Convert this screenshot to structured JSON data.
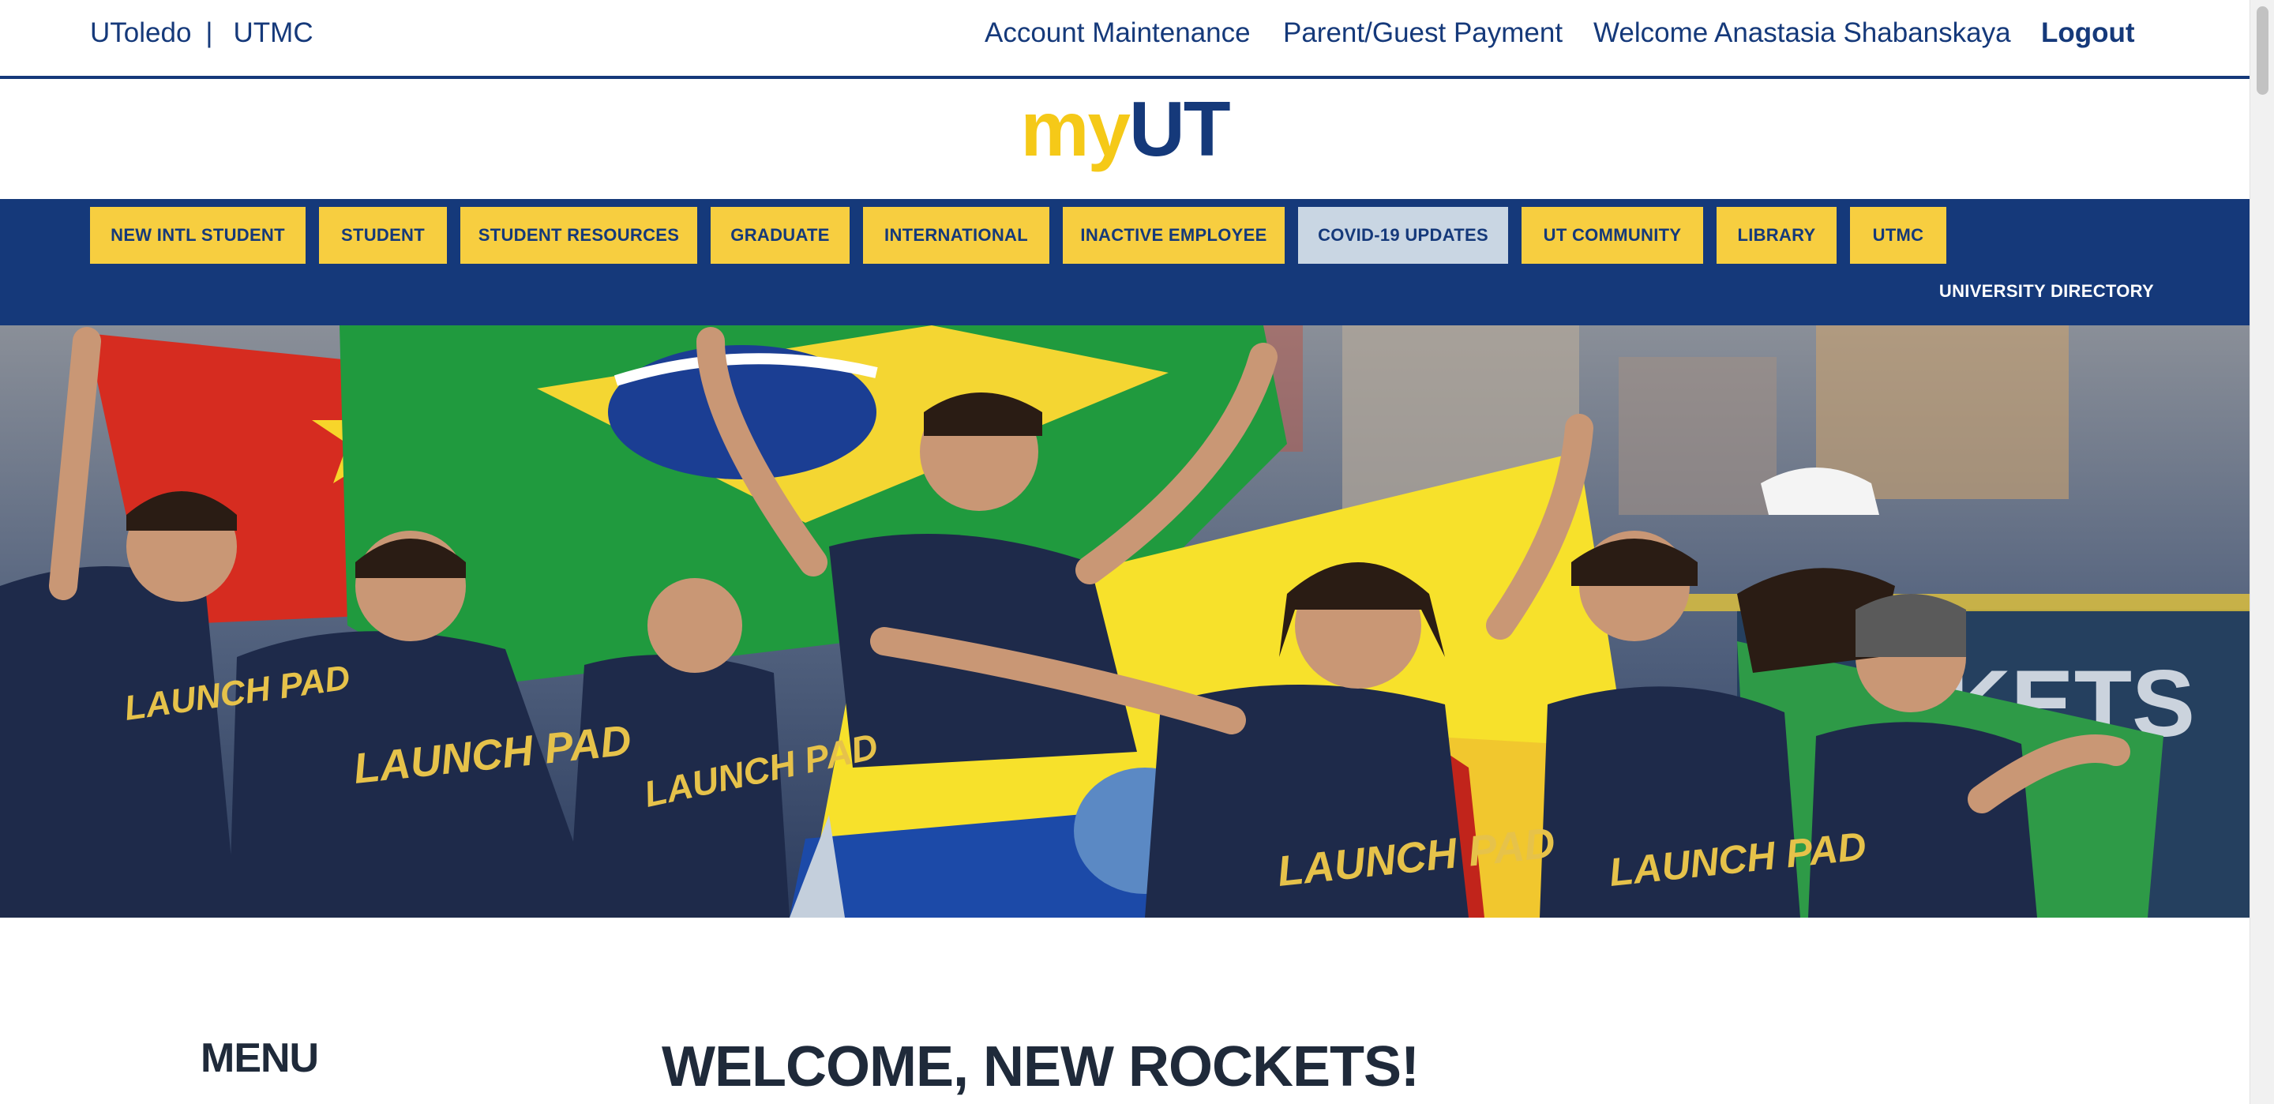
{
  "topbar": {
    "utoledo": "UToledo",
    "separator": "|",
    "utmc": "UTMC",
    "account_maintenance": "Account Maintenance",
    "parent_guest_payment": "Parent/Guest Payment",
    "welcome_text": "Welcome Anastasia Shabanskaya",
    "logout": "Logout"
  },
  "logo": {
    "my": "my",
    "ut": "UT"
  },
  "nav": {
    "items": [
      {
        "label": "NEW INTL STUDENT"
      },
      {
        "label": "STUDENT"
      },
      {
        "label": "STUDENT RESOURCES"
      },
      {
        "label": "GRADUATE"
      },
      {
        "label": "INTERNATIONAL"
      },
      {
        "label": "INACTIVE EMPLOYEE"
      },
      {
        "label": "COVID-19 UPDATES"
      },
      {
        "label": "UT COMMUNITY"
      },
      {
        "label": "LIBRARY"
      },
      {
        "label": "UTMC"
      }
    ],
    "directory": "UNIVERSITY DIRECTORY"
  },
  "hero": {
    "shirt_text": "LAUNCH PAD",
    "banner_text": "KETS"
  },
  "content": {
    "menu_heading": "MENU",
    "welcome_heading": "WELCOME, NEW ROCKETS!"
  },
  "colors": {
    "navy": "#15397a",
    "gold": "#f5c918",
    "button_gold": "#f7ce40",
    "button_highlight": "#c9d6e3"
  }
}
